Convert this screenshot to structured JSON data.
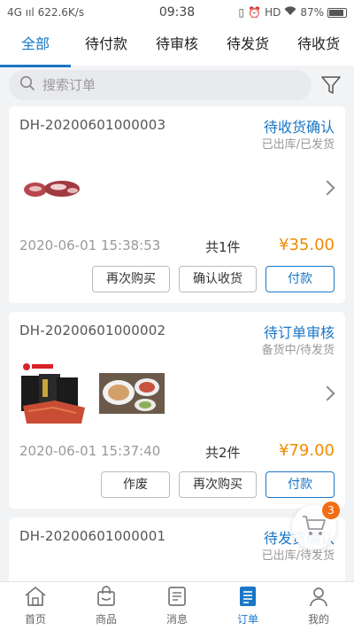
{
  "statusbar": {
    "left": "4G ııl  622.6K/s",
    "time": "09:38",
    "right": "HD",
    "battery": "87%"
  },
  "tabs": [
    {
      "label": "全部",
      "active": true
    },
    {
      "label": "待付款"
    },
    {
      "label": "待审核"
    },
    {
      "label": "待发货"
    },
    {
      "label": "待收货"
    }
  ],
  "search": {
    "placeholder": "搜索订单"
  },
  "orders": [
    {
      "order_no": "DH-20200601000003",
      "status": "待收货确认",
      "substatus": "已出库/已发货",
      "date": "2020-06-01 15:38:53",
      "count": "共1件",
      "price": "¥35.00",
      "buttons": [
        "再次购买",
        "确认收货",
        "付款"
      ]
    },
    {
      "order_no": "DH-20200601000002",
      "status": "待订单审核",
      "substatus": "备货中/待发货",
      "date": "2020-06-01 15:37:40",
      "count": "共2件",
      "price": "¥79.00",
      "buttons": [
        "作废",
        "再次购买",
        "付款"
      ]
    },
    {
      "order_no": "DH-20200601000001",
      "status": "待发货确认",
      "substatus": "已出库/待发货"
    }
  ],
  "cart": {
    "badge": "3"
  },
  "bottomnav": [
    {
      "label": "首页",
      "icon": "home-icon"
    },
    {
      "label": "商品",
      "icon": "bag-icon"
    },
    {
      "label": "消息",
      "icon": "message-icon"
    },
    {
      "label": "订单",
      "icon": "order-icon",
      "active": true
    },
    {
      "label": "我的",
      "icon": "profile-icon"
    }
  ],
  "colors": {
    "accent": "#1a76c6",
    "price": "#f08a00",
    "badge": "#f26d14"
  }
}
